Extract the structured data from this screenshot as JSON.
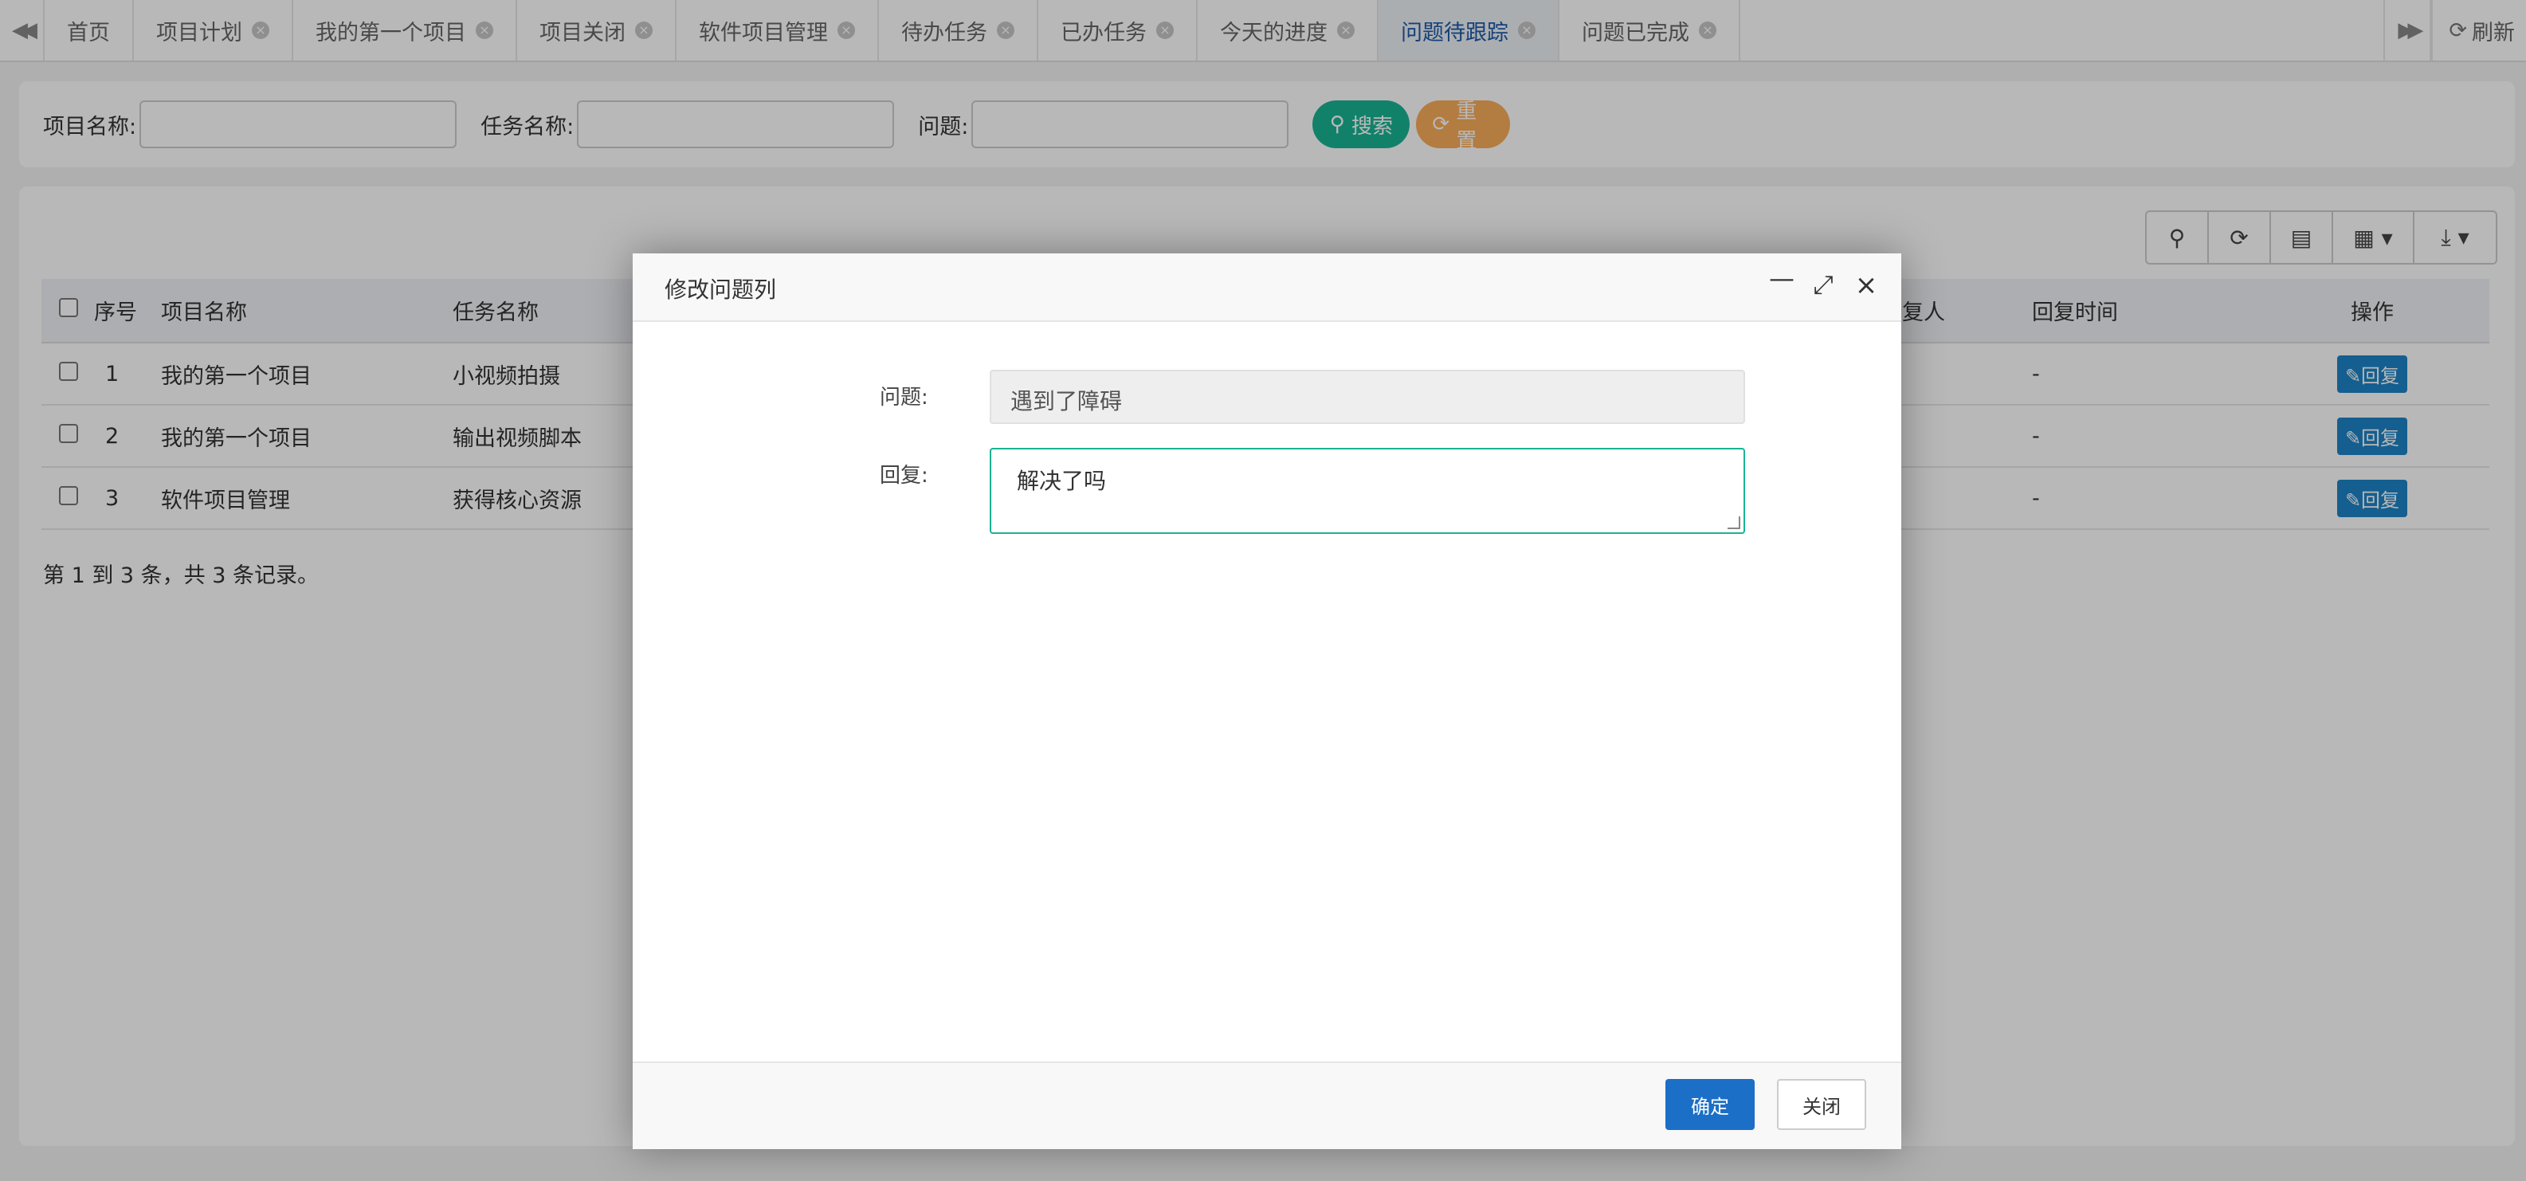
{
  "tabbar": {
    "back_icon": "double-chevron-left-icon",
    "forward_icon": "double-chevron-right-icon",
    "tabs": [
      {
        "label": "首页",
        "closable": false,
        "active": false
      },
      {
        "label": "项目计划",
        "closable": true,
        "active": false
      },
      {
        "label": "我的第一个项目",
        "closable": true,
        "active": false
      },
      {
        "label": "项目关闭",
        "closable": true,
        "active": false
      },
      {
        "label": "软件项目管理",
        "closable": true,
        "active": false
      },
      {
        "label": "待办任务",
        "closable": true,
        "active": false
      },
      {
        "label": "已办任务",
        "closable": true,
        "active": false
      },
      {
        "label": "今天的进度",
        "closable": true,
        "active": false
      },
      {
        "label": "问题待跟踪",
        "closable": true,
        "active": true
      },
      {
        "label": "问题已完成",
        "closable": true,
        "active": false
      }
    ],
    "refresh_label": "刷新"
  },
  "search": {
    "project_name_label": "项目名称:",
    "project_name_value": "",
    "task_name_label": "任务名称:",
    "task_name_value": "",
    "question_label": "问题:",
    "question_value": "",
    "search_button": "搜索",
    "reset_button": "重置"
  },
  "table": {
    "headers": {
      "seq": "序号",
      "project": "项目名称",
      "task": "任务名称",
      "reply_partial": "复",
      "replier": "回复人",
      "reply_time": "回复时间",
      "action": "操作"
    },
    "rows": [
      {
        "seq": "1",
        "project": "我的第一个项目",
        "task": "小视频拍摄",
        "replier": "-",
        "reply_time": "-",
        "action": "回复"
      },
      {
        "seq": "2",
        "project": "我的第一个项目",
        "task": "输出视频脚本",
        "replier": "-",
        "reply_time": "-",
        "action": "回复"
      },
      {
        "seq": "3",
        "project": "软件项目管理",
        "task": "获得核心资源",
        "replier": "-",
        "reply_time": "-",
        "action": "回复"
      }
    ],
    "pager_text": "第 1 到 3 条，共 3 条记录。"
  },
  "modal": {
    "title": "修改问题列",
    "question_label": "问题:",
    "question_value": "遇到了障碍",
    "reply_label": "回复:",
    "reply_value": "解决了吗",
    "ok_button": "确定",
    "close_button": "关闭"
  },
  "colors": {
    "search_button": "#1ab394",
    "reset_button": "#f8ac59",
    "reply_button": "#1c84c6",
    "ok_button": "#1c6fc6",
    "active_tab_text": "#1e5aa8"
  }
}
